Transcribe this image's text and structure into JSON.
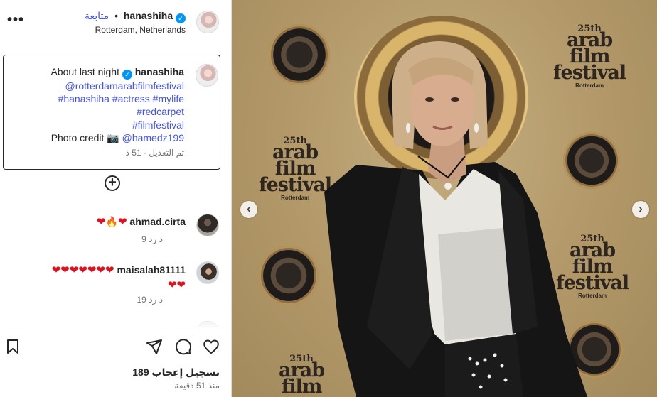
{
  "header": {
    "username": "hanashiha",
    "follow_label": "متابعة",
    "location": "Rotterdam, Netherlands",
    "more_icon": "more-options-icon"
  },
  "caption": {
    "username": "hanashiha",
    "line1": "About last night",
    "mention1": "@rotterdamarabfilmfestival",
    "tags_line": "#hanashiha #actress #mylife",
    "tag_redcarpet": "#redcarpet",
    "tag_filmfestival": "#filmfestival",
    "credit_label": "Photo credit 📷",
    "credit_mention": "@hamedz199",
    "meta": "تم التعديل · 51 د"
  },
  "comments": [
    {
      "username": "ahmad.cirta",
      "meta": "9 د    رد"
    },
    {
      "username": "maisalah81111",
      "meta": "19 د    رد"
    }
  ],
  "actions": {
    "likes": "189 تسجيل إعجاب",
    "time_ago": "منذ 51 دقيقة"
  },
  "photo": {
    "festival_number": "25th",
    "festival_word1": "arab",
    "festival_word2": "film",
    "festival_word3": "festival",
    "festival_city": "Rotterdam"
  },
  "colors": {
    "link": "#4150f7",
    "verified": "#0095f6",
    "heart": "#e0111e",
    "backdrop": "#b29868"
  }
}
